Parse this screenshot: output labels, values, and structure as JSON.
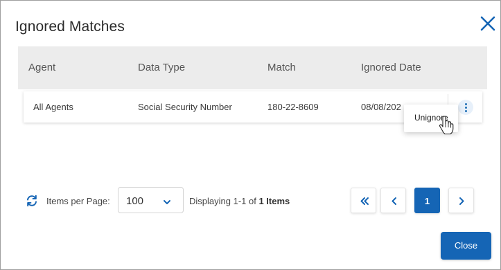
{
  "dialog": {
    "title": "Ignored Matches",
    "close_icon": "close-x-icon"
  },
  "table": {
    "headers": [
      "Agent",
      "Data Type",
      "Match",
      "Ignored Date"
    ],
    "rows": [
      {
        "agent": "All Agents",
        "data_type": "Social Security Number",
        "match": "180-22-8609",
        "ignored_date": "08/08/202"
      }
    ]
  },
  "row_menu": {
    "items": [
      "Unignore"
    ]
  },
  "pagination": {
    "items_per_page_label": "Items per Page:",
    "items_per_page_value": "100",
    "displaying_prefix": "Displaying 1-1 of",
    "displaying_count": "1 Items",
    "current_page": "1"
  },
  "footer": {
    "close_label": "Close"
  },
  "colors": {
    "accent": "#1565b5",
    "header_bg": "#ececec"
  }
}
